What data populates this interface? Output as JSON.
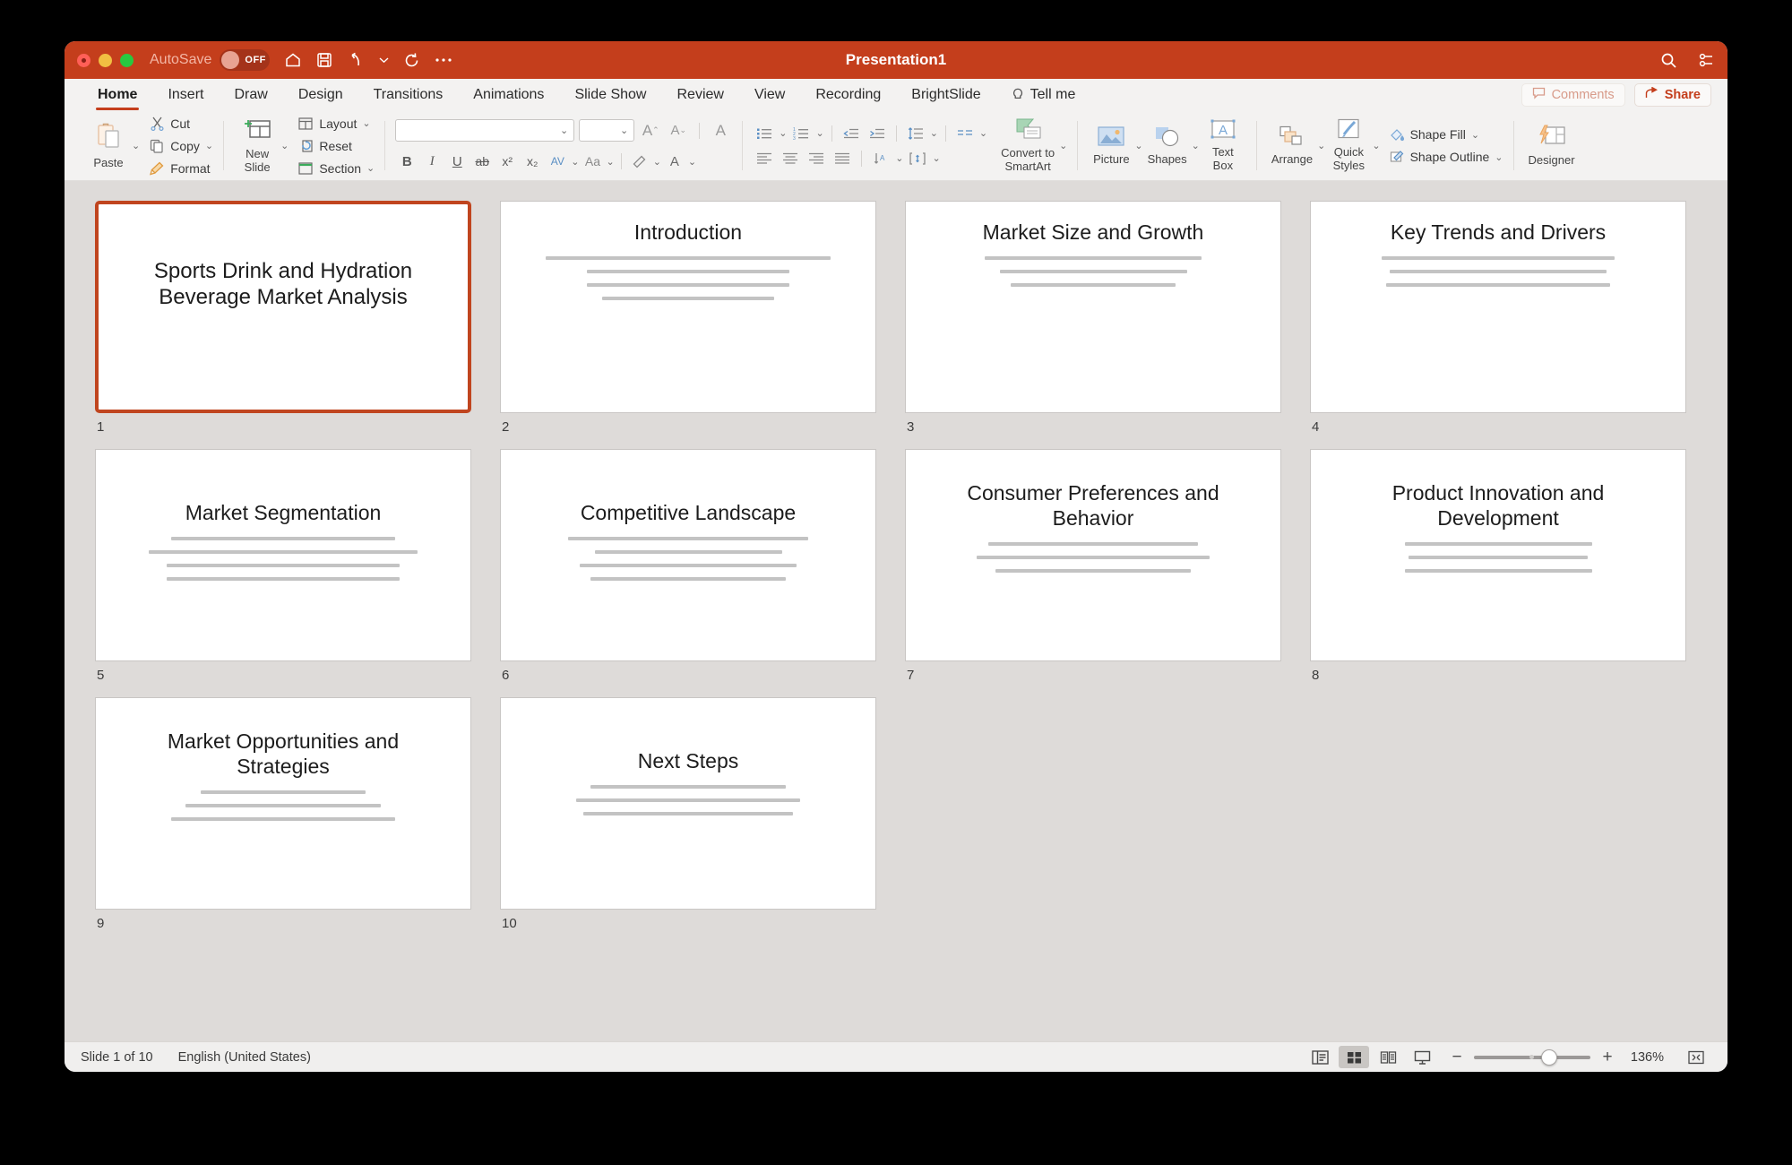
{
  "window": {
    "title": "Presentation1",
    "autosave_label": "AutoSave",
    "autosave_state": "OFF",
    "accent_color": "#c43e1c",
    "titlebar_icons": [
      "home-icon",
      "save-icon",
      "undo-icon",
      "redo-icon",
      "more-icon"
    ],
    "right_icons": [
      "search-icon",
      "ribbon-display-icon"
    ]
  },
  "tabs": [
    {
      "label": "Home",
      "active": true
    },
    {
      "label": "Insert",
      "active": false
    },
    {
      "label": "Draw",
      "active": false
    },
    {
      "label": "Design",
      "active": false
    },
    {
      "label": "Transitions",
      "active": false
    },
    {
      "label": "Animations",
      "active": false
    },
    {
      "label": "Slide Show",
      "active": false
    },
    {
      "label": "Review",
      "active": false
    },
    {
      "label": "View",
      "active": false
    },
    {
      "label": "Recording",
      "active": false
    },
    {
      "label": "BrightSlide",
      "active": false
    },
    {
      "label": "Tell me",
      "active": false
    }
  ],
  "tabs_right": {
    "comments_label": "Comments",
    "share_label": "Share"
  },
  "ribbon": {
    "clipboard": {
      "paste_label": "Paste",
      "cut_label": "Cut",
      "copy_label": "Copy",
      "format_label": "Format"
    },
    "slides": {
      "new_slide_label": "New\nSlide",
      "new_slide_line1": "New",
      "new_slide_line2": "Slide",
      "layout_label": "Layout",
      "reset_label": "Reset",
      "section_label": "Section"
    },
    "font": {
      "font_name_value": "",
      "font_size_value": "",
      "grow_label": "A",
      "shrink_label": "A",
      "clear_label": "A",
      "bold_label": "B",
      "italic_label": "I",
      "underline_label": "U",
      "strike_label": "ab",
      "superscript_label": "x²",
      "subscript_label": "x₂",
      "spacing_label": "AV",
      "case_label": "Aa",
      "highlight_label": "A",
      "fontcolor_label": "A"
    },
    "paragraph": {
      "bullets_name": "bullets-icon",
      "numbering_name": "numbering-icon",
      "decrease_indent_name": "decrease-indent-icon",
      "increase_indent_name": "increase-indent-icon",
      "line_spacing_name": "line-spacing-icon",
      "columns_name": "columns-icon",
      "convert_smartart_line1": "Convert to",
      "convert_smartart_line2": "SmartArt",
      "align_left_name": "align-left-icon",
      "align_center_name": "align-center-icon",
      "align_right_name": "align-right-icon",
      "justify_name": "justify-icon",
      "text_direction_name": "text-direction-icon",
      "align_text_name": "align-text-icon"
    },
    "insert": {
      "picture_label": "Picture",
      "shapes_label": "Shapes",
      "textbox_line1": "Text",
      "textbox_line2": "Box"
    },
    "drawing": {
      "arrange_label": "Arrange",
      "quick_styles_line1": "Quick",
      "quick_styles_line2": "Styles",
      "shape_fill_label": "Shape Fill",
      "shape_outline_label": "Shape Outline"
    },
    "designer": {
      "designer_label": "Designer"
    }
  },
  "slides": [
    {
      "number": "1",
      "title": "Sports Drink and Hydration Beverage Market Analysis",
      "selected": true,
      "is_title_slide": true,
      "body_lines": []
    },
    {
      "number": "2",
      "title": "Introduction",
      "selected": false,
      "is_title_slide": false,
      "body_lines": [
        76,
        54,
        54,
        46
      ]
    },
    {
      "number": "3",
      "title": "Market Size and Growth",
      "selected": false,
      "is_title_slide": false,
      "body_lines": [
        58,
        50,
        44,
        0
      ]
    },
    {
      "number": "4",
      "title": "Key Trends and Drivers",
      "selected": false,
      "is_title_slide": false,
      "body_lines": [
        62,
        58,
        60,
        0
      ]
    },
    {
      "number": "5",
      "title": "Market Segmentation",
      "selected": false,
      "is_title_slide": false,
      "body_lines": [
        60,
        72,
        62,
        62
      ]
    },
    {
      "number": "6",
      "title": "Competitive Landscape",
      "selected": false,
      "is_title_slide": false,
      "body_lines": [
        64,
        50,
        58,
        52
      ]
    },
    {
      "number": "7",
      "title": "Consumer Preferences and Behavior",
      "selected": false,
      "is_title_slide": false,
      "body_lines": [
        56,
        62,
        52,
        0
      ]
    },
    {
      "number": "8",
      "title": "Product Innovation and Development",
      "selected": false,
      "is_title_slide": false,
      "body_lines": [
        50,
        48,
        50,
        0
      ]
    },
    {
      "number": "9",
      "title": "Market Opportunities and Strategies",
      "selected": false,
      "is_title_slide": false,
      "body_lines": [
        44,
        52,
        60,
        0
      ]
    },
    {
      "number": "10",
      "title": "Next Steps",
      "selected": false,
      "is_title_slide": false,
      "body_lines": [
        52,
        60,
        56,
        0
      ]
    }
  ],
  "status": {
    "slide_position": "Slide 1 of 10",
    "language": "English (United States)",
    "views": [
      {
        "name": "normal-view-button",
        "active": false
      },
      {
        "name": "slide-sorter-view-button",
        "active": true
      },
      {
        "name": "reading-view-button",
        "active": false
      },
      {
        "name": "slide-show-button",
        "active": false
      }
    ],
    "zoom_out_label": "−",
    "zoom_in_label": "+",
    "zoom_level": "136%",
    "fit_button_name": "fit-to-window-button"
  }
}
